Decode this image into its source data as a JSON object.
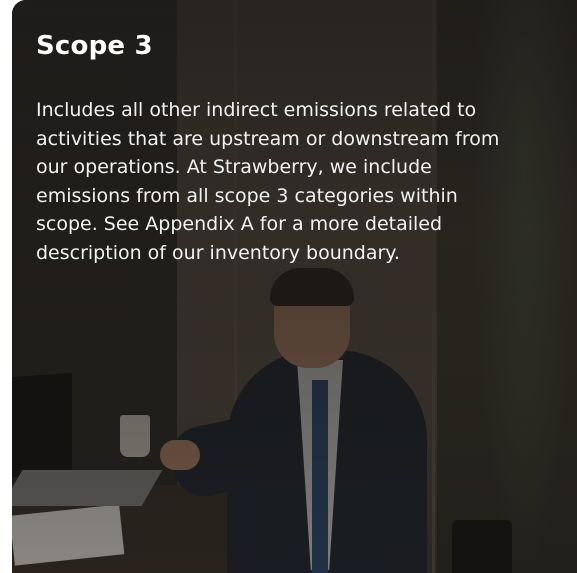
{
  "card": {
    "title": "Scope 3",
    "body": "Includes all other indirect emissions related to activities that are upstream or downstream from our operations. At Strawberry, we include emissions from all scope 3 categories within scope. See Appendix A for a more detailed description of our inventory boundary."
  },
  "colors": {
    "text": "#ffffff",
    "overlay": "#141210"
  }
}
